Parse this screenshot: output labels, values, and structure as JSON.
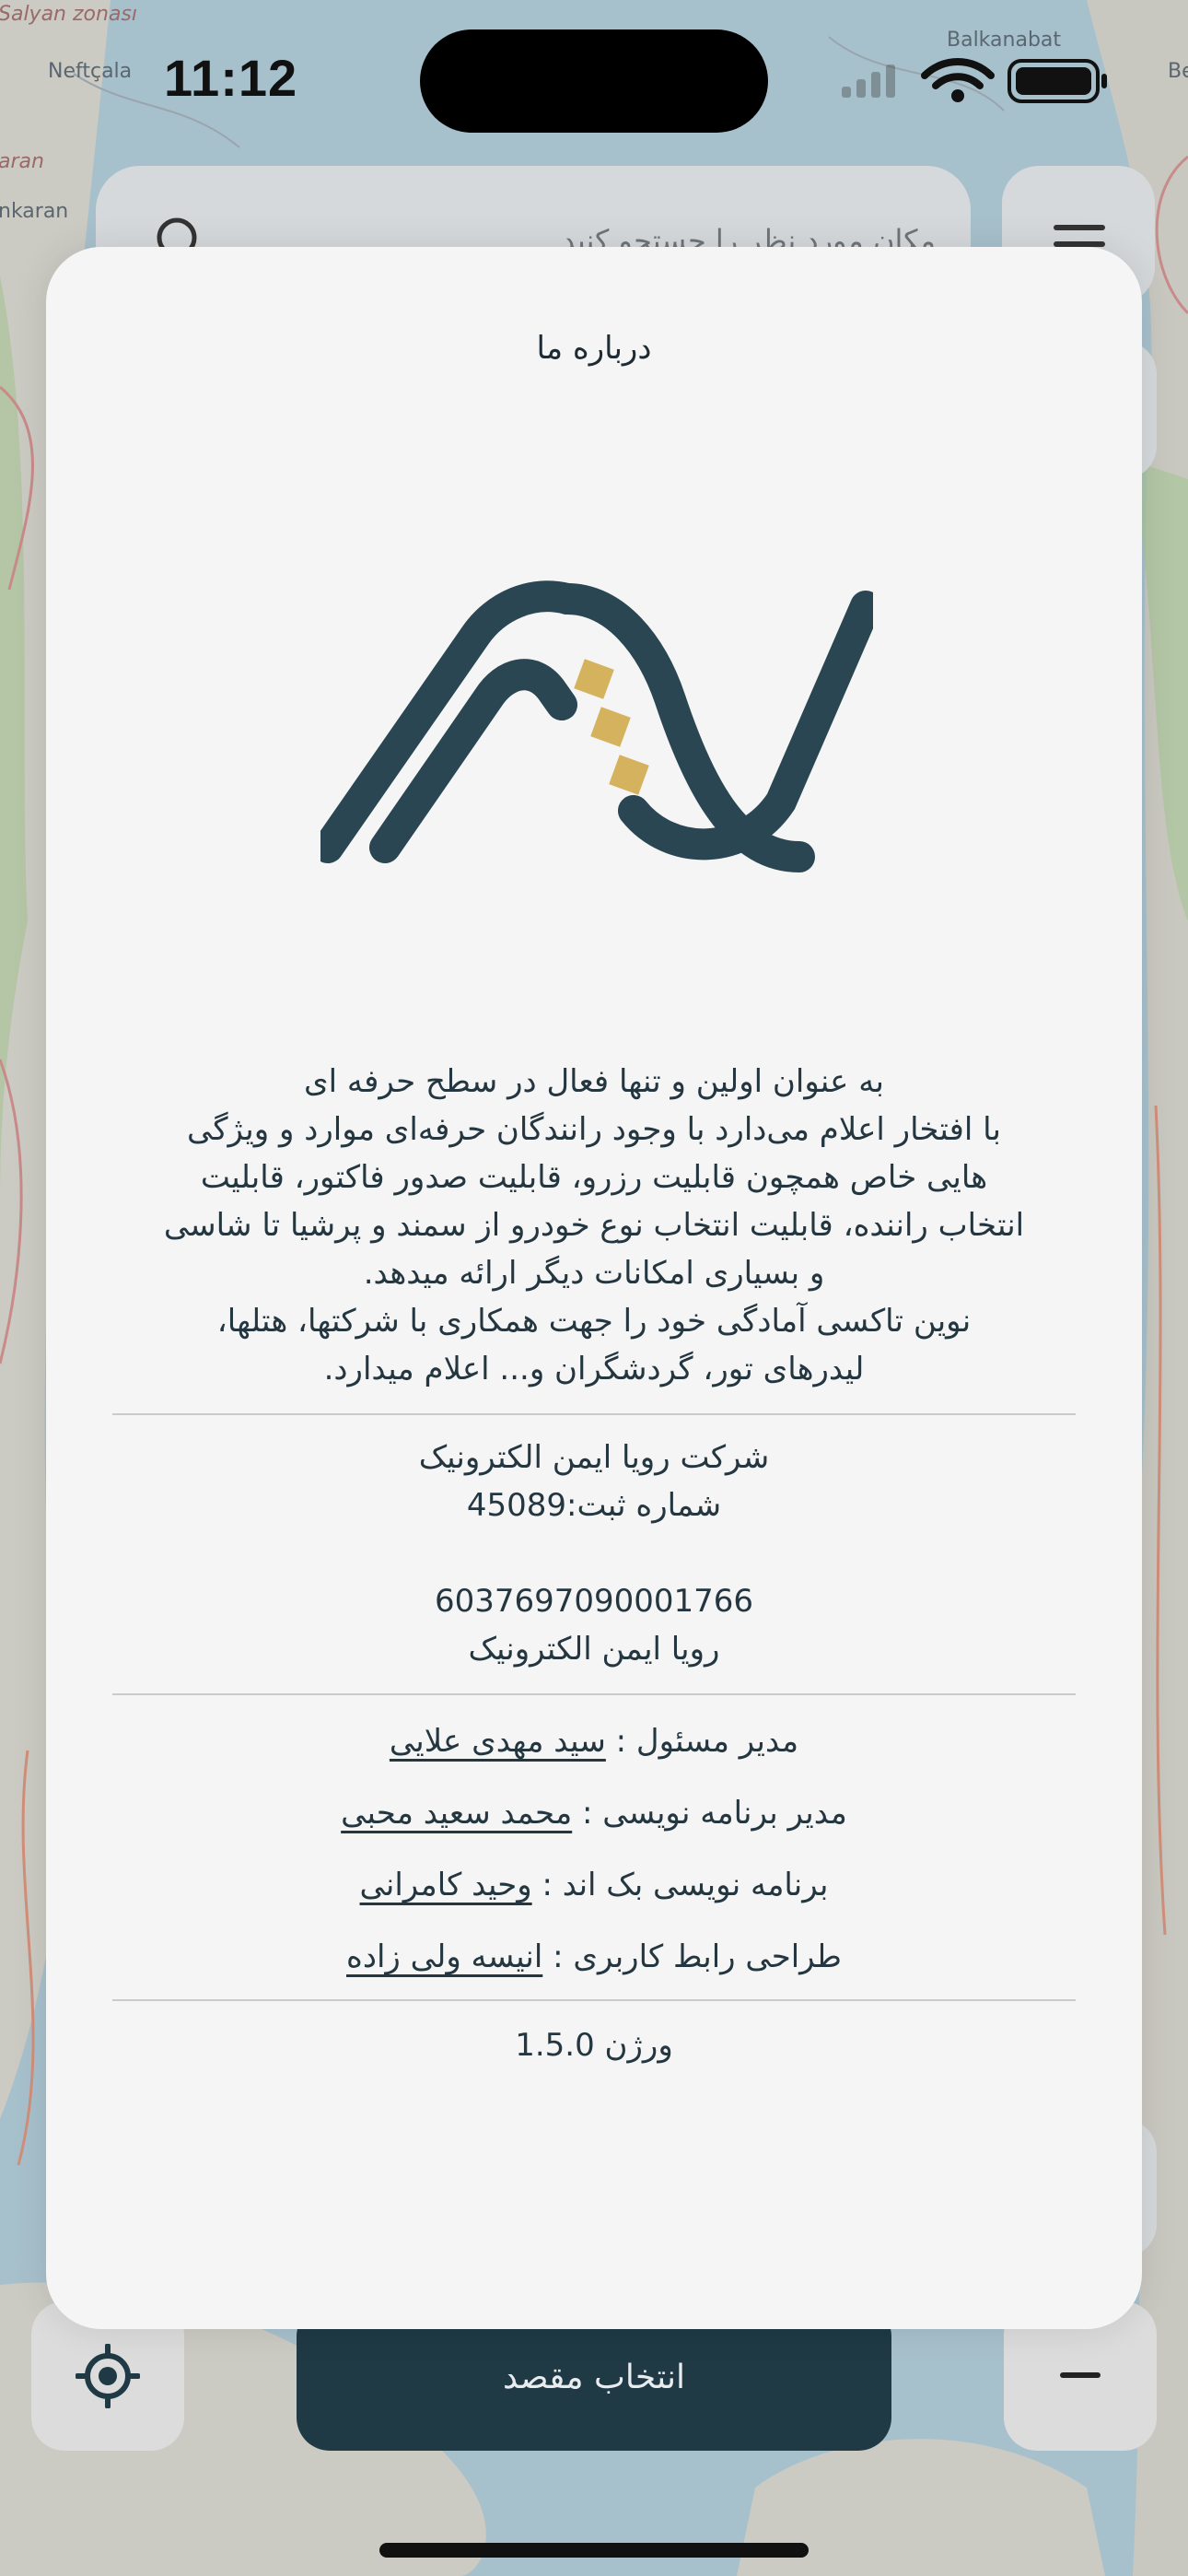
{
  "status_bar": {
    "time": "11:12"
  },
  "map": {
    "labels": [
      "Salyan zonası",
      "Neftçala",
      "Balkanabat",
      "Be",
      "aran",
      "nkaran"
    ]
  },
  "search": {
    "placeholder": "مکان مورد نظر را جستجو کنید"
  },
  "bottom_bar": {
    "select_destination_label": "انتخاب مقصد"
  },
  "about": {
    "title": "درباره ما",
    "description_lines": [
      "به عنوان اولین و تنها فعال در سطح حرفه ای",
      "با افتخار اعلام می‌دارد با وجود رانندگان حرفه‌ای موارد و ویژگی",
      "هایی خاص همچون قابلیت رزرو، قابلیت صدور فاکتور، قابلیت",
      "انتخاب راننده، قابلیت انتخاب نوع خودرو از سمند و پرشیا تا شاسی",
      "و بسیاری امکانات دیگر ارائه میدهد.",
      "نوین تاکسی آمادگی خود را جهت همکاری با شرکتها، هتلها،",
      "لیدرهای تور، گردشگران و... اعلام میدارد."
    ],
    "company_name": "شرکت رویا ایمن الکترونیک",
    "registration": "شماره ثبت:45089",
    "account_number": "6037697090001766",
    "account_holder": "رویا ایمن الکترونیک",
    "staff": [
      {
        "role": "مدیر مسئول : ",
        "name": "سید مهدی علایی"
      },
      {
        "role": "مدیر برنامه نویسی : ",
        "name": "محمد سعید محبی"
      },
      {
        "role": "برنامه نویسی بک اند : ",
        "name": "وحید کامرانی"
      },
      {
        "role": "طراحی رابط کاربری : ",
        "name": "انیسه ولی زاده"
      }
    ],
    "version": "ورژن 1.5.0"
  },
  "colors": {
    "brand_dark": "#1f3a45",
    "logo_gold": "#d4b25e",
    "sheet_bg": "#f5f5f5",
    "map_land": "#c9c9c2",
    "map_water": "#a9c3cf"
  },
  "icons": [
    "search-icon",
    "menu-icon",
    "wifi-icon",
    "battery-icon",
    "locate-icon",
    "minus-icon"
  ]
}
